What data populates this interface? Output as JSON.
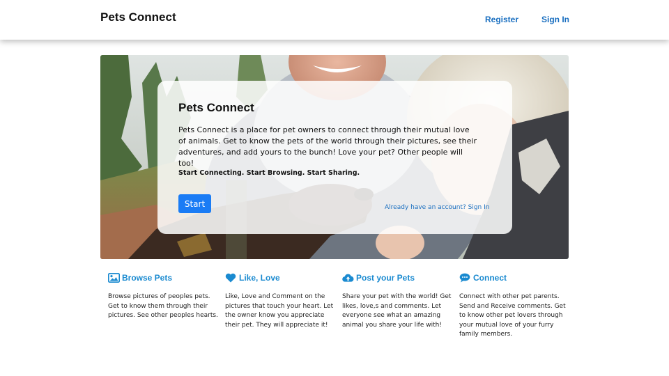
{
  "header": {
    "brand": "Pets Connect",
    "register_label": "Register",
    "signin_label": "Sign In"
  },
  "hero": {
    "title": "Pets Connect",
    "description": "Pets Connect is a place for pet owners to connect through their mutual love of animals. Get to know the pets of the world through their pictures, see their adventures, and add yours to the bunch! Love your pet? Other people will too!",
    "tagline": "Start Connecting. Start Browsing. Start Sharing.",
    "start_label": "Start",
    "signin_prompt": "Already have an account? Sign In"
  },
  "features": [
    {
      "icon": "image-icon",
      "title": "Browse Pets",
      "text": "Browse pictures of peoples pets. Get to know them through their pictures. See other peoples hearts."
    },
    {
      "icon": "heart-icon",
      "title": "Like, Love",
      "text": "Like, Love and Comment on the pictures that touch your heart. Let the owner know you appreciate their pet. They will appreciate it!"
    },
    {
      "icon": "cloud-upload-icon",
      "title": "Post your Pets",
      "text": "Share your pet with the world! Get likes, love,s and comments. Let everyone see what an amazing animal you share your life with!"
    },
    {
      "icon": "chat-bubble-icon",
      "title": "Connect",
      "text": "Connect with other pet parents. Send and Receive comments. Get to know other pet lovers through your mutual love of your furry family members."
    }
  ],
  "colors": {
    "accent": "#1a8ad0",
    "link": "#1a6fc0",
    "button": "#1a7cf5"
  }
}
